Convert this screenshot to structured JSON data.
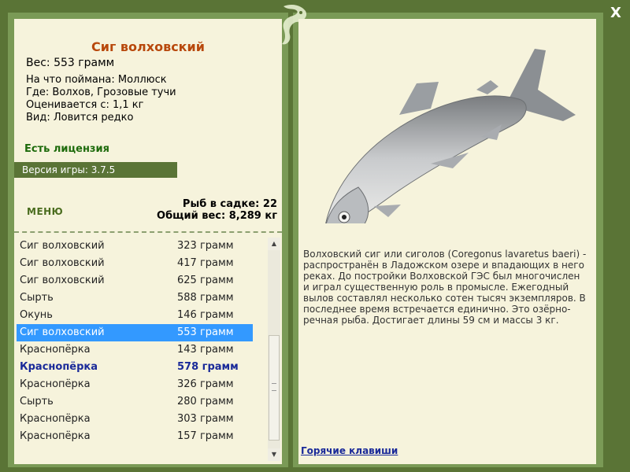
{
  "fish": {
    "title": "Сиг волховский",
    "weight": "Вес: 553 грамм",
    "bait": "На что поймана: Моллюск",
    "place": "Где: Волхов, Грозовые тучи",
    "value": "Оценивается с: 1,1 кг",
    "kind": "Вид: Ловится редко"
  },
  "license": "Есть лицензия",
  "version": "Версия игры: 3.7.5",
  "menu_label": "МЕНЮ",
  "cage": {
    "count": "Рыб в садке: 22",
    "total": "Общий вес: 8,289 кг"
  },
  "list": [
    {
      "name": "Сиг волховский",
      "weight": "323 грамм"
    },
    {
      "name": "Сиг волховский",
      "weight": "417 грамм"
    },
    {
      "name": "Сиг волховский",
      "weight": "625 грамм"
    },
    {
      "name": "Сырть",
      "weight": "588 грамм"
    },
    {
      "name": "Окунь",
      "weight": "146 грамм"
    },
    {
      "name": "Сиг волховский",
      "weight": "553 грамм"
    },
    {
      "name": "Краснопёрка",
      "weight": "143 грамм"
    },
    {
      "name": "Краснопёрка",
      "weight": "578 грамм"
    },
    {
      "name": "Краснопёрка",
      "weight": "326 грамм"
    },
    {
      "name": "Сырть",
      "weight": "280 грамм"
    },
    {
      "name": "Краснопёрка",
      "weight": "303 грамм"
    },
    {
      "name": "Краснопёрка",
      "weight": "157 грамм"
    }
  ],
  "description": "Волховский сиг или сиголов (Coregonus lavaretus baeri) - распространён в Ладожском озере и впадающих в него реках. До постройки Волховской ГЭС был многочислен и играл существенную роль в промысле. Ежегодный вылов составлял несколько сотен тысяч экземпляров. В последнее время встречается единично. Это озёрно-речная рыба. Достигает длины 59 см и массы 3 кг.",
  "hotkeys": "Горячие клавиши",
  "close_label": "X",
  "icons": {
    "close": "close-icon",
    "logo": "fish-logo-icon",
    "scroll_up": "arrow-up-icon",
    "scroll_down": "arrow-down-icon"
  },
  "colors": {
    "frame": "#5a7436",
    "panel": "#f6f3dc",
    "title": "#b8480c",
    "license": "#1e6b0c",
    "selected": "#3399ff",
    "highlight": "#1a2a99"
  }
}
